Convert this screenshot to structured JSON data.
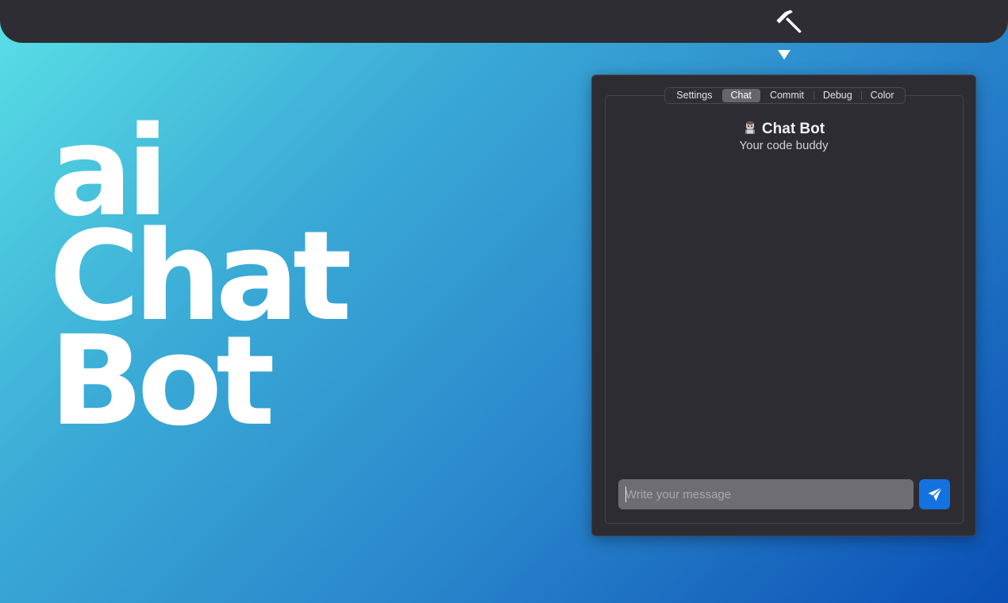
{
  "hero": {
    "line1": "ai",
    "line2": "Chat",
    "line3": "Bot"
  },
  "menubar": {
    "status_icon": "hammer-icon"
  },
  "popover": {
    "tabs": [
      {
        "label": "Settings",
        "active": false
      },
      {
        "label": "Chat",
        "active": true
      },
      {
        "label": "Commit",
        "active": false
      },
      {
        "label": "Debug",
        "active": false
      },
      {
        "label": "Color",
        "active": false
      }
    ],
    "header": {
      "icon": "bot-avatar-icon",
      "title": "Chat Bot",
      "subtitle": "Your code buddy"
    },
    "composer": {
      "placeholder": "Write your message",
      "value": "",
      "send_icon": "paper-plane-icon"
    }
  },
  "colors": {
    "accent": "#1372e0",
    "window_bg": "#2d2c32",
    "menubar_bg": "#2e2d33",
    "gradient_start": "#5ae0e6",
    "gradient_end": "#0a4fb4"
  }
}
